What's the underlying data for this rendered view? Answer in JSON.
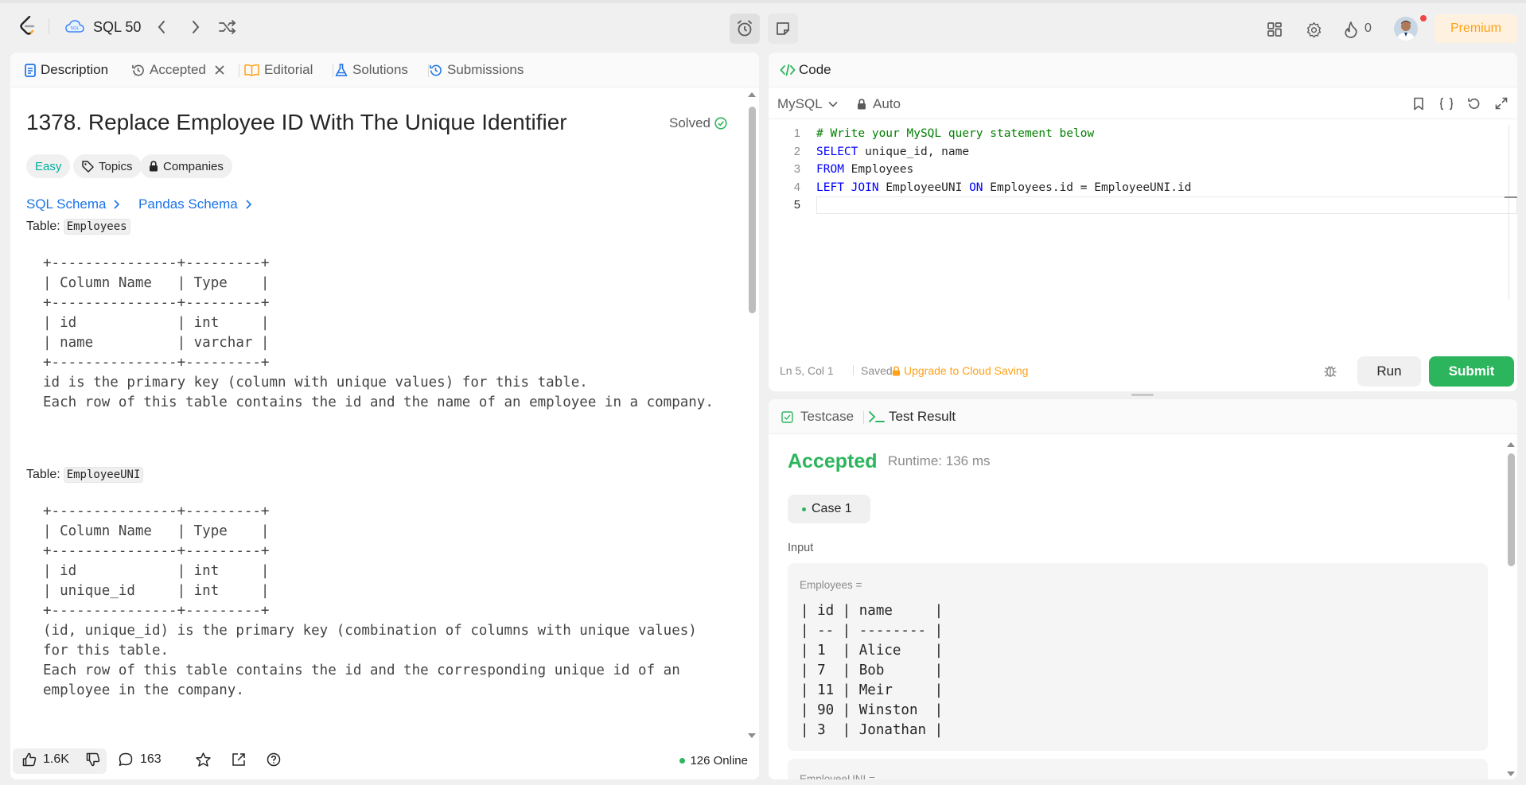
{
  "topbar": {
    "list_title": "SQL 50",
    "streak": "0",
    "premium": "Premium"
  },
  "left_tabs": {
    "description": "Description",
    "accepted": "Accepted",
    "editorial": "Editorial",
    "solutions": "Solutions",
    "submissions": "Submissions"
  },
  "problem": {
    "title": "1378. Replace Employee ID With The Unique Identifier",
    "status": "Solved",
    "difficulty": "Easy",
    "topics": "Topics",
    "companies": "Companies",
    "sql_schema": "SQL Schema",
    "pandas_schema": "Pandas Schema",
    "table_label": "Table:",
    "table1_name": "Employees",
    "table1_ascii": "+---------------+---------+\n| Column Name   | Type    |\n+---------------+---------+\n| id            | int     |\n| name          | varchar |\n+---------------+---------+\nid is the primary key (column with unique values) for this table.\nEach row of this table contains the id and the name of an employee in a company.",
    "table2_name": "EmployeeUNI",
    "table2_ascii": "+---------------+---------+\n| Column Name   | Type    |\n+---------------+---------+\n| id            | int     |\n| unique_id     | int     |\n+---------------+---------+\n(id, unique_id) is the primary key (combination of columns with unique values)\nfor this table.\nEach row of this table contains the id and the corresponding unique id of an\nemployee in the company."
  },
  "footer": {
    "likes": "1.6K",
    "comments": "163",
    "online": "126 Online"
  },
  "code_panel": {
    "title": "Code",
    "language": "MySQL",
    "mode": "Auto",
    "lines": [
      {
        "num": "1",
        "text": "# Write your MySQL query statement below"
      },
      {
        "num": "2",
        "kw1": "SELECT",
        "rest": " unique_id, name"
      },
      {
        "num": "3",
        "kw1": "FROM",
        "rest": " Employees"
      },
      {
        "num": "4",
        "kw1": "LEFT JOIN",
        "rest": " EmployeeUNI ",
        "kw2": "ON",
        "rest2": " Employees.id = EmployeeUNI.id"
      },
      {
        "num": "5"
      }
    ],
    "cursor_pos": "Ln 5, Col 1",
    "saved": "Saved",
    "upgrade": "Upgrade to Cloud Saving",
    "run": "Run",
    "submit": "Submit"
  },
  "result": {
    "testcase_tab": "Testcase",
    "result_tab": "Test Result",
    "status": "Accepted",
    "runtime": "Runtime: 136 ms",
    "case": "Case 1",
    "input_label": "Input",
    "var1_label": "Employees =",
    "var1_table": "| id | name     |\n| -- | -------- |\n| 1  | Alice    |\n| 7  | Bob      |\n| 11 | Meir     |\n| 90 | Winston  |\n| 3  | Jonathan |",
    "var2_label": "EmployeeUNI ="
  },
  "colors": {
    "accent_green": "#2db55d",
    "link_blue": "#1a73e8",
    "easy_teal": "#00af9b",
    "premium_orange": "#ffa116",
    "keyword_blue": "#0000ff",
    "comment_green": "#008000"
  }
}
